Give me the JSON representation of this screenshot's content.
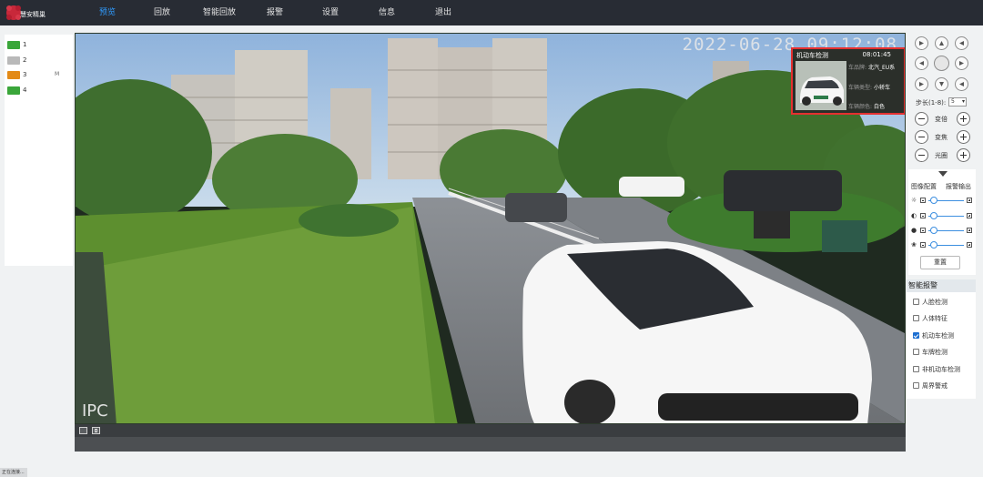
{
  "brand": {
    "name": "慧安精巢"
  },
  "nav": {
    "items": [
      {
        "label": "预览",
        "active": true
      },
      {
        "label": "回放"
      },
      {
        "label": "智能回放"
      },
      {
        "label": "报警"
      },
      {
        "label": "设置"
      },
      {
        "label": "信息"
      },
      {
        "label": "退出"
      }
    ]
  },
  "channels": [
    {
      "number": "1",
      "color": "#3aa63a",
      "tag": ""
    },
    {
      "number": "2",
      "color": "#b9b9b9",
      "tag": ""
    },
    {
      "number": "3",
      "color": "#e38a17",
      "tag": "M"
    },
    {
      "number": "4",
      "color": "#3aa63a",
      "tag": ""
    }
  ],
  "video": {
    "timestamp": "2022-06-28 09:12:08",
    "label": "IPC",
    "detection": {
      "title": "机动车检测",
      "time": "08:01:45",
      "fields": [
        {
          "key": "车品牌:",
          "value": "北汽_EU系"
        },
        {
          "key": "车辆类型:",
          "value": "小轿车"
        },
        {
          "key": "车辆颜色:",
          "value": "白色"
        }
      ]
    }
  },
  "ptz": {
    "step_label": "步长(1-8):",
    "step_value": "5",
    "zoom_label": "变倍",
    "focus_label": "变焦",
    "iris_label": "光圈"
  },
  "image_config": {
    "tab_image": "图像配置",
    "tab_alarm_out": "报警输出",
    "sliders": [
      {
        "icon": "brightness-icon",
        "value": 0.15
      },
      {
        "icon": "contrast-icon",
        "value": 0.15
      },
      {
        "icon": "saturation-icon",
        "value": 0.15
      },
      {
        "icon": "hue-icon",
        "value": 0.15
      }
    ],
    "reset_label": "重置"
  },
  "smart_alarm": {
    "title": "智能报警",
    "items": [
      {
        "label": "人脸检测",
        "checked": false
      },
      {
        "label": "人体特征",
        "checked": false
      },
      {
        "label": "机动车检测",
        "checked": true
      },
      {
        "label": "车牌检测",
        "checked": false
      },
      {
        "label": "非机动车检测",
        "checked": false
      },
      {
        "label": "周界警戒",
        "checked": false
      }
    ]
  },
  "status": {
    "text": "正在连接..."
  },
  "colors": {
    "accent": "#2f9bff",
    "alarm_box": "#e53030",
    "topbar": "#282c34"
  }
}
